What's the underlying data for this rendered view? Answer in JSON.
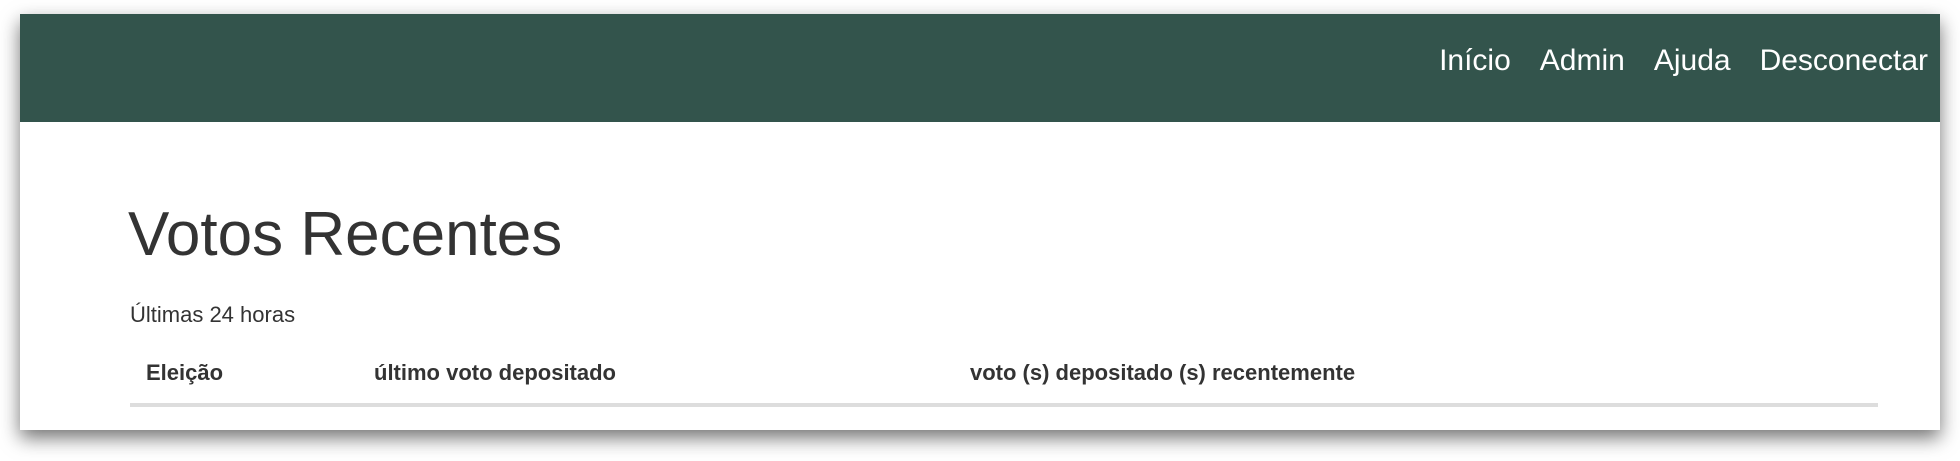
{
  "nav": {
    "items": [
      "Início",
      "Admin",
      "Ajuda",
      "Desconectar"
    ]
  },
  "page": {
    "title": "Votos Recentes",
    "subtitle": "Últimas 24 horas"
  },
  "table": {
    "columns": [
      "Eleição",
      "último voto depositado",
      "voto (s) depositado (s) recentemente"
    ],
    "rows": []
  },
  "colors": {
    "navbar": "#33544c"
  }
}
